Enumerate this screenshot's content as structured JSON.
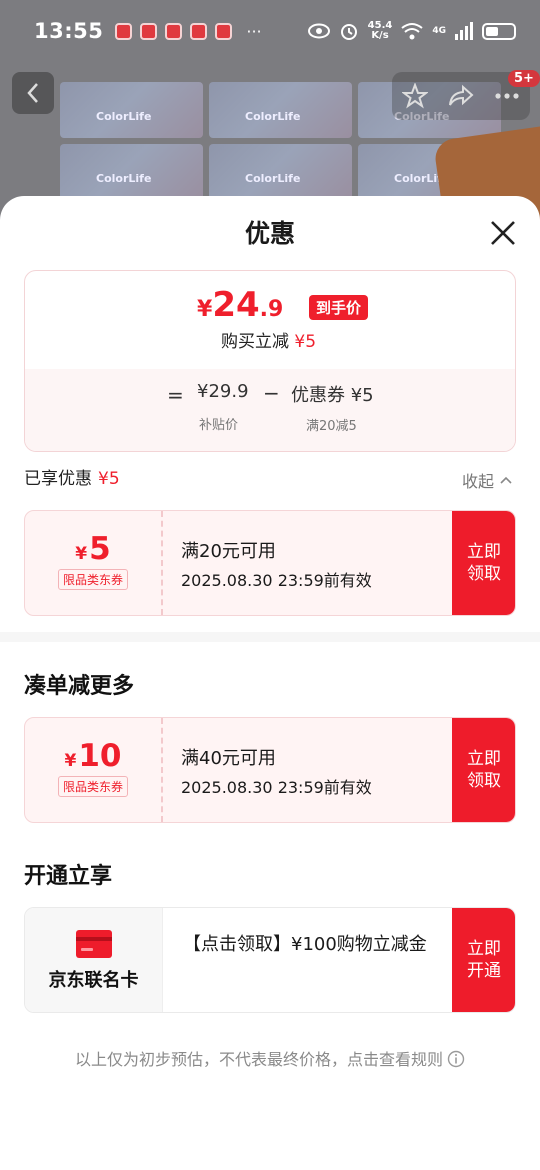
{
  "status_bar": {
    "time": "13:55",
    "more": "···",
    "net_speed_value": "45.4",
    "net_speed_unit": "K/s",
    "signal": "4G"
  },
  "backdrop": {
    "product_text": "ColorLife",
    "cart_badge": "5+"
  },
  "sheet": {
    "title": "优惠",
    "price_card": {
      "currency": "¥",
      "price_int": "24",
      "price_dec": ".9",
      "final_tag": "到手价",
      "buy_off_label": "购买立减",
      "buy_off_value": "¥5",
      "equals": "=",
      "subsidy_price": "¥29.9",
      "subsidy_label": "补贴价",
      "minus": "−",
      "coupon_value": "优惠券 ¥5",
      "coupon_label": "满20减5"
    },
    "enjoyed_label": "已享优惠",
    "enjoyed_value": "¥5",
    "collapse_label": "收起",
    "coupons_enjoyed": [
      {
        "symbol": "¥",
        "amount": "5",
        "type": "限品类东券",
        "condition": "满20元可用",
        "expiry": "2025.08.30 23:59前有效",
        "button": "立即领取"
      }
    ],
    "more_section_title": "凑单减更多",
    "coupons_more": [
      {
        "symbol": "¥",
        "amount": "10",
        "type": "限品类东券",
        "condition": "满40元可用",
        "expiry": "2025.08.30 23:59前有效",
        "button": "立即领取"
      }
    ],
    "open_section_title": "开通立享",
    "card_offer": {
      "name": "京东联名卡",
      "description": "【点击领取】¥100购物立减金",
      "button": "立即开通"
    },
    "footer_note": "以上仅为初步预估，不代表最终价格，点击查看规则"
  },
  "colors": {
    "accent_red": "#ef1f2c",
    "button_red": "#ee1c2b",
    "coupon_bg": "#fff4f4"
  }
}
